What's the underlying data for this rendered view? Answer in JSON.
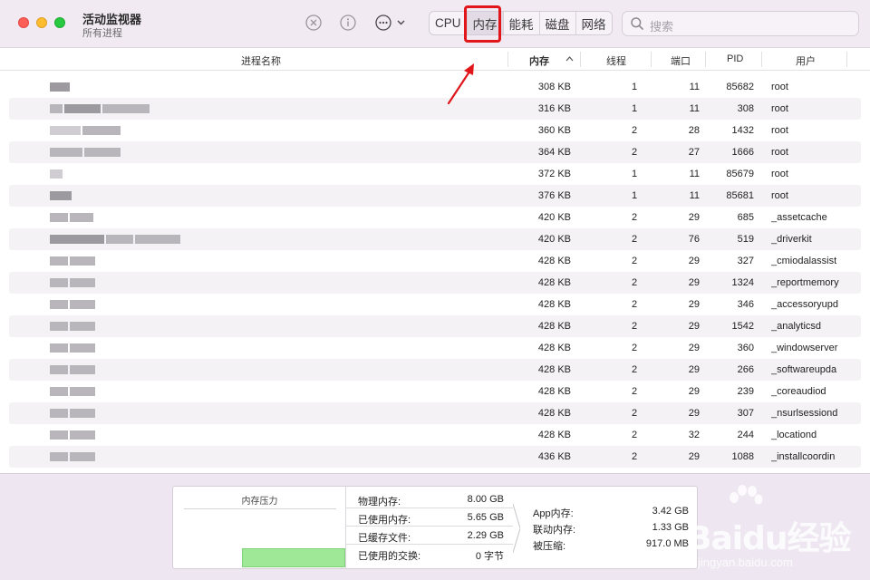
{
  "app": {
    "title": "活动监视器",
    "subtitle": "所有进程"
  },
  "toolbar": {
    "tabs": [
      "CPU",
      "内存",
      "能耗",
      "磁盘",
      "网络"
    ],
    "active_tab": "内存",
    "search_placeholder": "搜索"
  },
  "columns": {
    "name": "进程名称",
    "memory": "内存",
    "threads": "线程",
    "ports": "端口",
    "pid": "PID",
    "user": "用户"
  },
  "processes": [
    {
      "memory": "308 KB",
      "threads": "1",
      "ports": "11",
      "pid": "85682",
      "user": "root"
    },
    {
      "memory": "316 KB",
      "threads": "1",
      "ports": "11",
      "pid": "308",
      "user": "root"
    },
    {
      "memory": "360 KB",
      "threads": "2",
      "ports": "28",
      "pid": "1432",
      "user": "root"
    },
    {
      "memory": "364 KB",
      "threads": "2",
      "ports": "27",
      "pid": "1666",
      "user": "root"
    },
    {
      "memory": "372 KB",
      "threads": "1",
      "ports": "11",
      "pid": "85679",
      "user": "root"
    },
    {
      "memory": "376 KB",
      "threads": "1",
      "ports": "11",
      "pid": "85681",
      "user": "root"
    },
    {
      "memory": "420 KB",
      "threads": "2",
      "ports": "29",
      "pid": "685",
      "user": "_assetcache"
    },
    {
      "memory": "420 KB",
      "threads": "2",
      "ports": "76",
      "pid": "519",
      "user": "_driverkit"
    },
    {
      "memory": "428 KB",
      "threads": "2",
      "ports": "29",
      "pid": "327",
      "user": "_cmiodalassist"
    },
    {
      "memory": "428 KB",
      "threads": "2",
      "ports": "29",
      "pid": "1324",
      "user": "_reportmemory"
    },
    {
      "memory": "428 KB",
      "threads": "2",
      "ports": "29",
      "pid": "346",
      "user": "_accessoryupd"
    },
    {
      "memory": "428 KB",
      "threads": "2",
      "ports": "29",
      "pid": "1542",
      "user": "_analyticsd"
    },
    {
      "memory": "428 KB",
      "threads": "2",
      "ports": "29",
      "pid": "360",
      "user": "_windowserver"
    },
    {
      "memory": "428 KB",
      "threads": "2",
      "ports": "29",
      "pid": "266",
      "user": "_softwareupda"
    },
    {
      "memory": "428 KB",
      "threads": "2",
      "ports": "29",
      "pid": "239",
      "user": "_coreaudiod"
    },
    {
      "memory": "428 KB",
      "threads": "2",
      "ports": "29",
      "pid": "307",
      "user": "_nsurlsessiond"
    },
    {
      "memory": "428 KB",
      "threads": "2",
      "ports": "32",
      "pid": "244",
      "user": "_locationd"
    },
    {
      "memory": "436 KB",
      "threads": "2",
      "ports": "29",
      "pid": "1088",
      "user": "_installcoordin"
    }
  ],
  "memory_panel": {
    "pressure_label": "内存压力",
    "stats": [
      {
        "label": "物理内存:",
        "value": "8.00 GB"
      },
      {
        "label": "已使用内存:",
        "value": "5.65 GB"
      },
      {
        "label": "已缓存文件:",
        "value": "2.29 GB"
      },
      {
        "label": "已使用的交换:",
        "value": "0 字节"
      }
    ],
    "breakdown": [
      {
        "label": "App内存:",
        "value": "3.42 GB"
      },
      {
        "label": "联动内存:",
        "value": "1.33 GB"
      },
      {
        "label": "被压缩:",
        "value": "917.0 MB"
      }
    ]
  },
  "icons": [
    "close-circle-icon",
    "info-icon",
    "more-icon",
    "chevron-down-icon",
    "search-icon",
    "sort-ascending-icon"
  ],
  "colors": {
    "toolbar_bg": "#f1eaf3",
    "highlight": "#e0161b",
    "pressure_graph": "#9ee898"
  },
  "watermark": {
    "brand": "Baidu经验",
    "url": "jingyan.baidu.com"
  }
}
